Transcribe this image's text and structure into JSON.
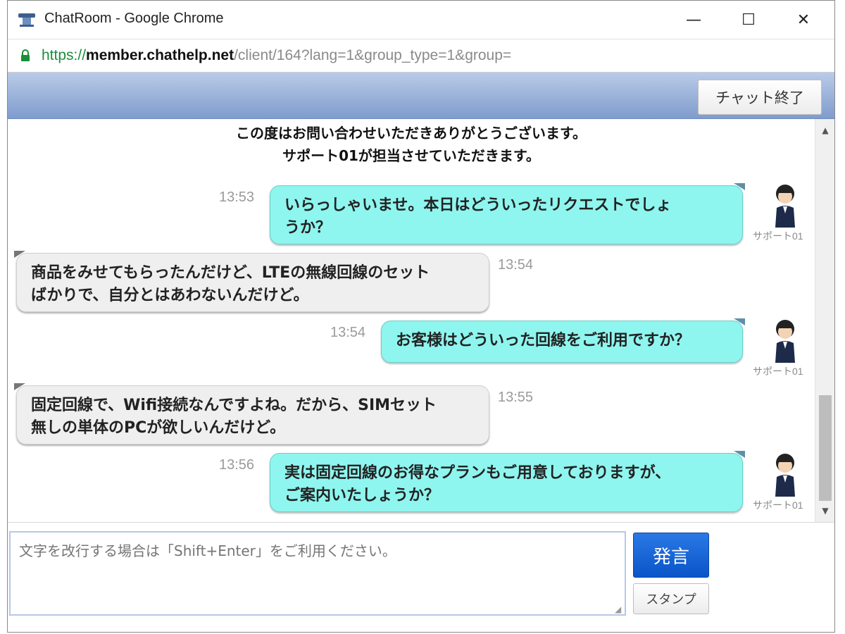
{
  "window": {
    "title": "ChatRoom - Google Chrome",
    "minimize_glyph": "—",
    "maximize_glyph": "☐",
    "close_glyph": "✕"
  },
  "address": {
    "scheme": "https://",
    "host": "member.chathelp.net",
    "path": "/client/164?lang=1&group_type=1&group="
  },
  "header": {
    "end_chat_label": "チャット終了"
  },
  "system_messages": [
    "この度はお問い合わせいただきありがとうございます。",
    "サポート01が担当させていただきます。"
  ],
  "messages": [
    {
      "sender": "agent",
      "time": "13:53",
      "lines": [
        "いらっしゃいませ。本日はどういったリクエストでしょ",
        "うか？"
      ],
      "agent_name": "サポート01"
    },
    {
      "sender": "client",
      "time": "13:54",
      "lines": [
        "商品をみせてもらったんだけど、LTEの無線回線のセット",
        "ばかりで、自分とはあわないんだけど。"
      ]
    },
    {
      "sender": "agent",
      "time": "13:54",
      "lines": [
        "お客様はどういった回線をご利用ですか？"
      ],
      "agent_name": "サポート01"
    },
    {
      "sender": "client",
      "time": "13:55",
      "lines": [
        "固定回線で、Wifi接続なんですよね。だから、SIMセット",
        "無しの単体のPCが欲しいんだけど。"
      ]
    },
    {
      "sender": "agent",
      "time": "13:56",
      "lines": [
        "実は固定回線のお得なプランもご用意しておりますが、",
        "ご案内いたしょうか？"
      ],
      "agent_name": "サポート01"
    }
  ],
  "composer": {
    "placeholder": "文字を改行する場合は「Shift+Enter」をご利用ください。",
    "send_label": "発言",
    "stamp_label": "スタンプ"
  },
  "colors": {
    "agent_bubble": "#8ff5ef",
    "client_bubble": "#efefef",
    "header_band": "#9bb3db",
    "send_button": "#1566d8",
    "secure_green": "#1b8e3a"
  }
}
